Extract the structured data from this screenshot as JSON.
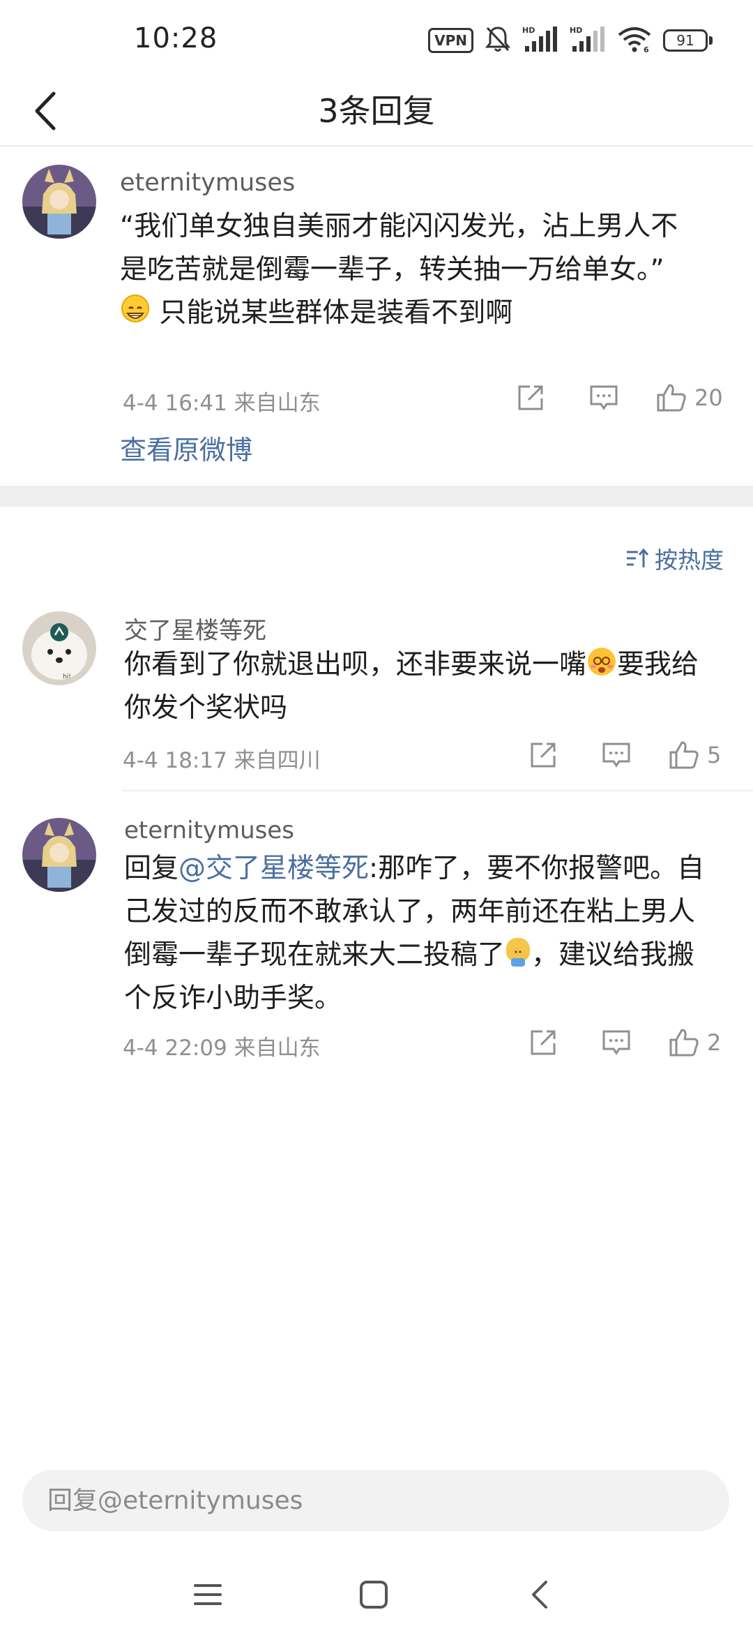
{
  "status_bar": {
    "time": "10:28",
    "vpn_label": "VPN",
    "battery_level": "91",
    "icons": [
      "vpn-icon",
      "bell-muted-icon",
      "signal-hd-icon",
      "signal-hd-icon",
      "wifi-icon",
      "battery-icon"
    ]
  },
  "header": {
    "title": "3条回复",
    "back_icon": "chevron-left-icon"
  },
  "original_post": {
    "username": "eternitymuses",
    "text_line1": "“我们单女独自美丽才能闪闪发光，沾上男人不",
    "text_line2": "是吃苦就是倒霉一辈子，转关抽一万给单女。”",
    "text_line3": "只能说某些群体是装看不到啊",
    "emoji": "grinning-face",
    "meta": "4-4 16:41  来自山东",
    "likes": "20",
    "view_original": "查看原微博"
  },
  "sort": {
    "label": "按热度",
    "icon": "sort-icon"
  },
  "replies": [
    {
      "username": "交了星楼等死",
      "text_part1": "你看到了你就退出呗，还非要来说一嘴",
      "emoji": "dizzy-face",
      "text_part2": "要我给",
      "text_line2": "你发个奖状吗",
      "meta": "4-4 18:17  来自四川",
      "likes": "5"
    },
    {
      "username": "eternitymuses",
      "prefix": "回复",
      "mention": "@交了星楼等死",
      "text_part1": ":那咋了，要不你报警吧。自",
      "text_line2": "己发过的反而不敢承认了，两年前还在粘上男人",
      "text_line3a": "倒霉一辈子现在就来大二投稿了",
      "emoji": "hugging-face",
      "text_line3b": "，建议给我搬",
      "text_line4": "个反诈小助手奖。",
      "meta": "4-4 22:09  来自山东",
      "likes": "2"
    }
  ],
  "input": {
    "placeholder": "回复@eternitymuses"
  },
  "nav": {
    "icons": [
      "menu-icon",
      "home-square-icon",
      "back-triangle-icon"
    ]
  },
  "colors": {
    "link": "#4a6fa0",
    "meta": "#8f8f8f",
    "divider": "#efeff1"
  }
}
